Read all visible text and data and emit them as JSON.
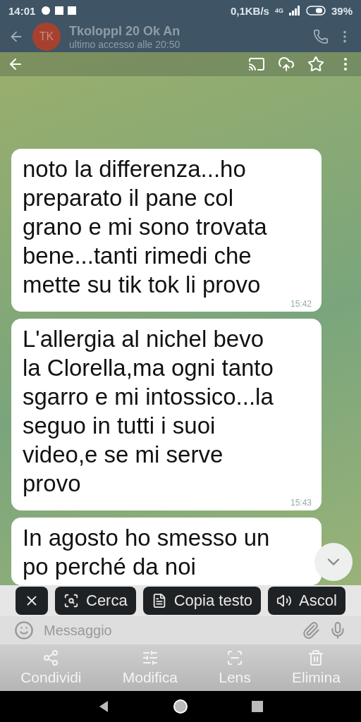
{
  "status_bar": {
    "time": "14:01",
    "speed": "0,1KB/s",
    "network": "4G",
    "battery": "39%"
  },
  "chat_header": {
    "avatar": "TK",
    "title": "Tkoloppl 20 Ok An",
    "subtitle": "ultimo accesso alle 20:50"
  },
  "messages": [
    {
      "text": "noto la differenza...ho preparato il pane col grano e mi sono trovata bene...tanti rimedi che mette su tik tok li provo",
      "time": "15:42"
    },
    {
      "text": "L'allergia al nichel bevo la Clorella,ma ogni tanto sgarro e mi intossico...la seguo in tutti i suoi video,e se mi serve provo",
      "time": "15:43"
    },
    {
      "text": "In agosto ho smesso un po perché da noi"
    }
  ],
  "chips": [
    {
      "kind": "close"
    },
    {
      "kind": "search",
      "label": "Cerca"
    },
    {
      "kind": "copy",
      "label": "Copia testo"
    },
    {
      "kind": "listen",
      "label": "Ascol"
    }
  ],
  "composer": {
    "placeholder": "Messaggio"
  },
  "actions": [
    {
      "kind": "share",
      "label": "Condividi"
    },
    {
      "kind": "edit",
      "label": "Modifica"
    },
    {
      "kind": "lens",
      "label": "Lens"
    },
    {
      "kind": "delete",
      "label": "Elimina"
    }
  ]
}
